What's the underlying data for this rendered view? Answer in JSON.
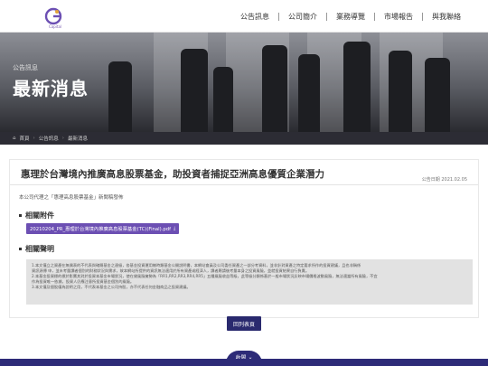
{
  "header": {
    "logo_text": "Capital",
    "nav": [
      "公告訊息",
      "公司簡介",
      "業務導覽",
      "市場報告",
      "與我聯絡"
    ]
  },
  "hero": {
    "subtitle": "公告訊息",
    "title": "最新消息"
  },
  "breadcrumb": [
    "首頁",
    "公告訊息",
    "最新消息"
  ],
  "article": {
    "title": "惠理於台灣境內推廣高息股票基金，助投資者捕捉亞洲高息優質企業潛力",
    "date": "公告日期 2021.02.05",
    "intro": "本公司代理之「惠理高息股票基金」新聞稿發佈",
    "attachments_heading": "相關附件",
    "attachment_label": "20210204_PR_惠理於台灣境內推廣高息股票基金(TC)(Final).pdf",
    "disclaimer_heading": "相關聲明",
    "disclaimer": [
      "1.本文僅立之資產在無偶表的不代表與確屬基金之達級，各基金投資運用樣時類基金公開說明書，本網站會員及公司委任資產之一部分考資料，並非針對資產之特定要求所作的投資建議，且也非稱係",
      "資訊源傳 申，並未考量讀者個別的財務狀況與需求，故本網站所提供的資訊無法適用於所有資產或經濟人，讀者屬請後考量本身之投資風險，並就投資結果自行負責。",
      "2.本基金投資標的標於影響其對於投資本基金市場狀況，使在貸風險擁勢為「RR1,RR2,RR3,RR4,RR5」五種風險收益等級，此等級分類係基於一般市場狀況反映市場價格波動風險，無法適當所有風險，不宜",
      "作為投資唯一依據，投資人仍應注意所投資基金個別的風險。",
      "3.本文僅及個股僅為說明之用，不代表本基金之公司持股，亦不代表任何金融商品之投資建議。"
    ],
    "back_button": "回列表頁"
  },
  "footer": {
    "tab_label": "收闔"
  }
}
